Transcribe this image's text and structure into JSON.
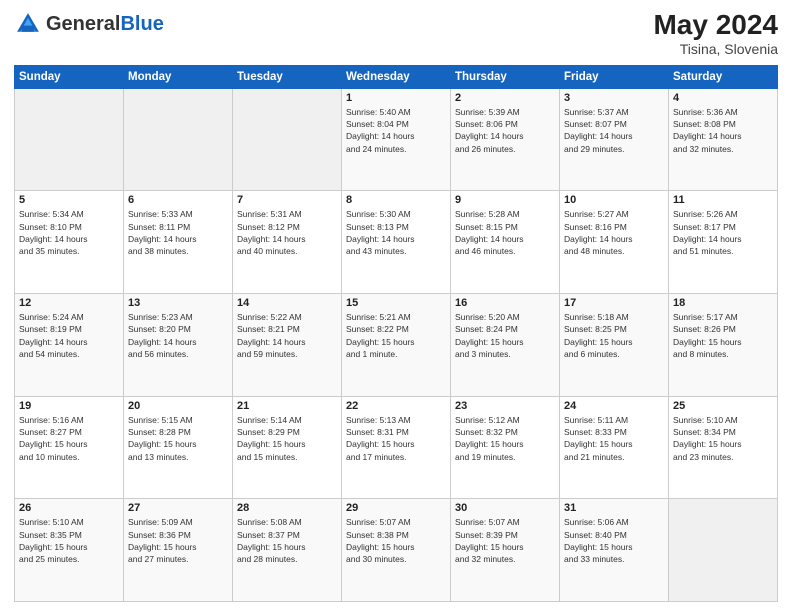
{
  "header": {
    "logo_general": "General",
    "logo_blue": "Blue",
    "month_year": "May 2024",
    "location": "Tisina, Slovenia"
  },
  "weekdays": [
    "Sunday",
    "Monday",
    "Tuesday",
    "Wednesday",
    "Thursday",
    "Friday",
    "Saturday"
  ],
  "weeks": [
    [
      {
        "day": "",
        "info": ""
      },
      {
        "day": "",
        "info": ""
      },
      {
        "day": "",
        "info": ""
      },
      {
        "day": "1",
        "info": "Sunrise: 5:40 AM\nSunset: 8:04 PM\nDaylight: 14 hours\nand 24 minutes."
      },
      {
        "day": "2",
        "info": "Sunrise: 5:39 AM\nSunset: 8:06 PM\nDaylight: 14 hours\nand 26 minutes."
      },
      {
        "day": "3",
        "info": "Sunrise: 5:37 AM\nSunset: 8:07 PM\nDaylight: 14 hours\nand 29 minutes."
      },
      {
        "day": "4",
        "info": "Sunrise: 5:36 AM\nSunset: 8:08 PM\nDaylight: 14 hours\nand 32 minutes."
      }
    ],
    [
      {
        "day": "5",
        "info": "Sunrise: 5:34 AM\nSunset: 8:10 PM\nDaylight: 14 hours\nand 35 minutes."
      },
      {
        "day": "6",
        "info": "Sunrise: 5:33 AM\nSunset: 8:11 PM\nDaylight: 14 hours\nand 38 minutes."
      },
      {
        "day": "7",
        "info": "Sunrise: 5:31 AM\nSunset: 8:12 PM\nDaylight: 14 hours\nand 40 minutes."
      },
      {
        "day": "8",
        "info": "Sunrise: 5:30 AM\nSunset: 8:13 PM\nDaylight: 14 hours\nand 43 minutes."
      },
      {
        "day": "9",
        "info": "Sunrise: 5:28 AM\nSunset: 8:15 PM\nDaylight: 14 hours\nand 46 minutes."
      },
      {
        "day": "10",
        "info": "Sunrise: 5:27 AM\nSunset: 8:16 PM\nDaylight: 14 hours\nand 48 minutes."
      },
      {
        "day": "11",
        "info": "Sunrise: 5:26 AM\nSunset: 8:17 PM\nDaylight: 14 hours\nand 51 minutes."
      }
    ],
    [
      {
        "day": "12",
        "info": "Sunrise: 5:24 AM\nSunset: 8:19 PM\nDaylight: 14 hours\nand 54 minutes."
      },
      {
        "day": "13",
        "info": "Sunrise: 5:23 AM\nSunset: 8:20 PM\nDaylight: 14 hours\nand 56 minutes."
      },
      {
        "day": "14",
        "info": "Sunrise: 5:22 AM\nSunset: 8:21 PM\nDaylight: 14 hours\nand 59 minutes."
      },
      {
        "day": "15",
        "info": "Sunrise: 5:21 AM\nSunset: 8:22 PM\nDaylight: 15 hours\nand 1 minute."
      },
      {
        "day": "16",
        "info": "Sunrise: 5:20 AM\nSunset: 8:24 PM\nDaylight: 15 hours\nand 3 minutes."
      },
      {
        "day": "17",
        "info": "Sunrise: 5:18 AM\nSunset: 8:25 PM\nDaylight: 15 hours\nand 6 minutes."
      },
      {
        "day": "18",
        "info": "Sunrise: 5:17 AM\nSunset: 8:26 PM\nDaylight: 15 hours\nand 8 minutes."
      }
    ],
    [
      {
        "day": "19",
        "info": "Sunrise: 5:16 AM\nSunset: 8:27 PM\nDaylight: 15 hours\nand 10 minutes."
      },
      {
        "day": "20",
        "info": "Sunrise: 5:15 AM\nSunset: 8:28 PM\nDaylight: 15 hours\nand 13 minutes."
      },
      {
        "day": "21",
        "info": "Sunrise: 5:14 AM\nSunset: 8:29 PM\nDaylight: 15 hours\nand 15 minutes."
      },
      {
        "day": "22",
        "info": "Sunrise: 5:13 AM\nSunset: 8:31 PM\nDaylight: 15 hours\nand 17 minutes."
      },
      {
        "day": "23",
        "info": "Sunrise: 5:12 AM\nSunset: 8:32 PM\nDaylight: 15 hours\nand 19 minutes."
      },
      {
        "day": "24",
        "info": "Sunrise: 5:11 AM\nSunset: 8:33 PM\nDaylight: 15 hours\nand 21 minutes."
      },
      {
        "day": "25",
        "info": "Sunrise: 5:10 AM\nSunset: 8:34 PM\nDaylight: 15 hours\nand 23 minutes."
      }
    ],
    [
      {
        "day": "26",
        "info": "Sunrise: 5:10 AM\nSunset: 8:35 PM\nDaylight: 15 hours\nand 25 minutes."
      },
      {
        "day": "27",
        "info": "Sunrise: 5:09 AM\nSunset: 8:36 PM\nDaylight: 15 hours\nand 27 minutes."
      },
      {
        "day": "28",
        "info": "Sunrise: 5:08 AM\nSunset: 8:37 PM\nDaylight: 15 hours\nand 28 minutes."
      },
      {
        "day": "29",
        "info": "Sunrise: 5:07 AM\nSunset: 8:38 PM\nDaylight: 15 hours\nand 30 minutes."
      },
      {
        "day": "30",
        "info": "Sunrise: 5:07 AM\nSunset: 8:39 PM\nDaylight: 15 hours\nand 32 minutes."
      },
      {
        "day": "31",
        "info": "Sunrise: 5:06 AM\nSunset: 8:40 PM\nDaylight: 15 hours\nand 33 minutes."
      },
      {
        "day": "",
        "info": ""
      }
    ]
  ]
}
